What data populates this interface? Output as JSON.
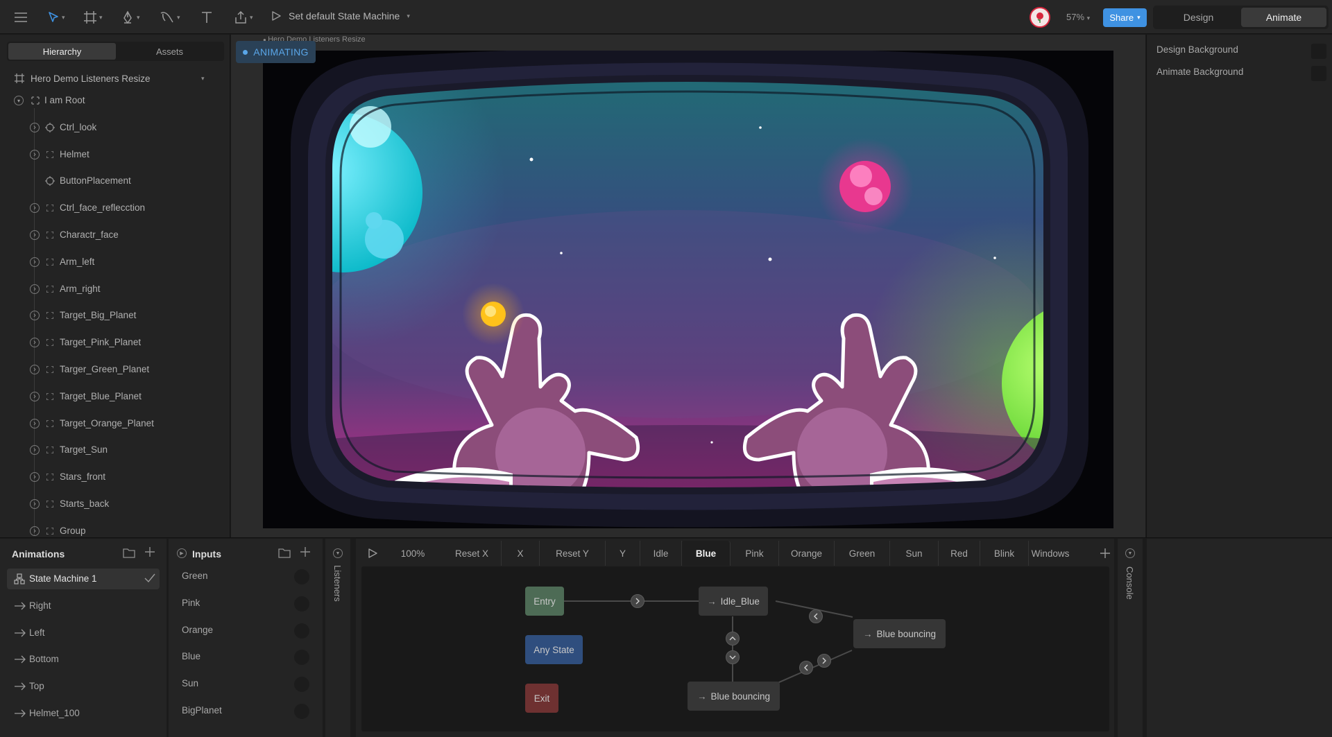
{
  "toolbar": {
    "state_machine_label": "Set default State Machine",
    "zoom": "57%",
    "share_label": "Share",
    "modes": [
      "Design",
      "Animate"
    ],
    "active_mode": "Animate"
  },
  "left_panel": {
    "tabs": [
      "Hierarchy",
      "Assets"
    ],
    "active_tab": "Hierarchy",
    "artboard_name": "Hero Demo Listeners Resize",
    "root_label": "I am Root",
    "items": [
      {
        "label": "Ctrl_look",
        "icon": "target-icon",
        "expandable": true
      },
      {
        "label": "Helmet",
        "icon": "group-icon",
        "expandable": true
      },
      {
        "label": "ButtonPlacement",
        "icon": "target-icon",
        "expandable": false
      },
      {
        "label": "Ctrl_face_reflecction",
        "icon": "group-icon",
        "expandable": true
      },
      {
        "label": "Charactr_face",
        "icon": "group-icon",
        "expandable": true
      },
      {
        "label": "Arm_left",
        "icon": "group-icon",
        "expandable": true
      },
      {
        "label": "Arm_right",
        "icon": "group-icon",
        "expandable": true
      },
      {
        "label": "Target_Big_Planet",
        "icon": "group-icon",
        "expandable": true
      },
      {
        "label": "Target_Pink_Planet",
        "icon": "group-icon",
        "expandable": true
      },
      {
        "label": "Targer_Green_Planet",
        "icon": "group-icon",
        "expandable": true
      },
      {
        "label": "Target_Blue_Planet",
        "icon": "group-icon",
        "expandable": true
      },
      {
        "label": "Target_Orange_Planet",
        "icon": "group-icon",
        "expandable": true
      },
      {
        "label": "Target_Sun",
        "icon": "group-icon",
        "expandable": true
      },
      {
        "label": "Stars_front",
        "icon": "group-icon",
        "expandable": true
      },
      {
        "label": "Starts_back",
        "icon": "group-icon",
        "expandable": true
      },
      {
        "label": "Group",
        "icon": "group-icon",
        "expandable": true
      }
    ]
  },
  "canvas": {
    "artboard_title": "Hero Demo Listeners Resize",
    "status_badge": "ANIMATING"
  },
  "right_panel": {
    "design_background": "Design Background",
    "animate_background": "Animate Background"
  },
  "animations_panel": {
    "title": "Animations",
    "items": [
      {
        "label": "State Machine 1",
        "type": "state-machine",
        "selected": true
      },
      {
        "label": "Right",
        "type": "timeline"
      },
      {
        "label": "Left",
        "type": "timeline"
      },
      {
        "label": "Bottom",
        "type": "timeline"
      },
      {
        "label": "Top",
        "type": "timeline"
      },
      {
        "label": "Helmet_100",
        "type": "timeline"
      }
    ]
  },
  "inputs_panel": {
    "title": "Inputs",
    "items": [
      "Green",
      "Pink",
      "Orange",
      "Blue",
      "Sun",
      "BigPlanet"
    ]
  },
  "side_strips": {
    "listeners": "Listeners",
    "console": "Console"
  },
  "state_machine": {
    "playback_speed": "100%",
    "layer_tabs": [
      "Reset X",
      "X",
      "Reset Y",
      "Y",
      "Idle",
      "Blue",
      "Pink",
      "Orange",
      "Green",
      "Sun",
      "Red",
      "Blink",
      "Windows"
    ],
    "active_layer": "Blue",
    "nodes": {
      "entry": "Entry",
      "any_state": "Any State",
      "exit": "Exit",
      "idle_blue": "Idle_Blue",
      "blue_bouncing_right": "Blue bouncing",
      "blue_bouncing_bottom": "Blue bouncing"
    }
  },
  "colors": {
    "accent_blue": "#3f92e2",
    "entry_node": "#4d6b55",
    "any_state_node": "#2f4e7e",
    "exit_node": "#6e3131",
    "animating_text": "#5aa6e8"
  }
}
